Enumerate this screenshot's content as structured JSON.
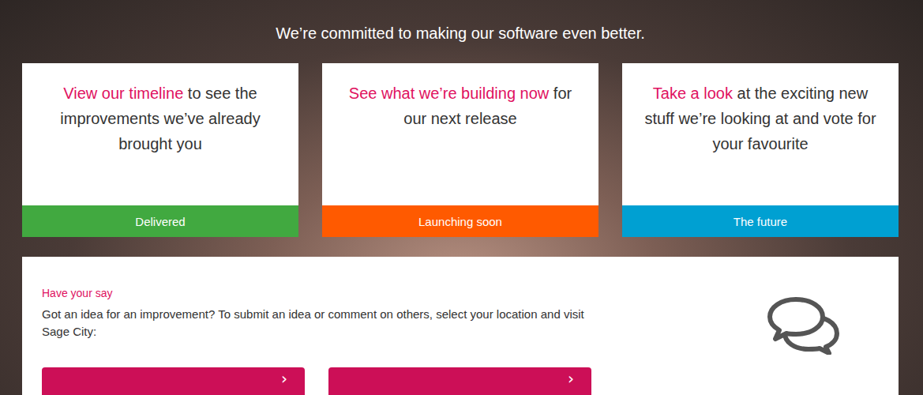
{
  "subtitle": "We’re committed to making our software even better.",
  "cards": [
    {
      "link": "View our timeline",
      "text": " to see the improvements we’ve already brought you",
      "status": "Delivered",
      "color": "#41a940"
    },
    {
      "link": "See what we’re building now",
      "text": " for our next release",
      "status": "Launching soon",
      "color": "#ff5a00"
    },
    {
      "link": "Take a look",
      "text": " at the exciting new stuff we’re looking at and vote for your favourite",
      "status": "The future",
      "color": "#00a0d2"
    }
  ],
  "feedback": {
    "label": "Have your say",
    "text": "Got an idea for an improvement? To submit an idea or comment on others, select your location and visit Sage City:",
    "buttons": [
      {
        "arrow": "›"
      },
      {
        "arrow": "›"
      }
    ]
  }
}
